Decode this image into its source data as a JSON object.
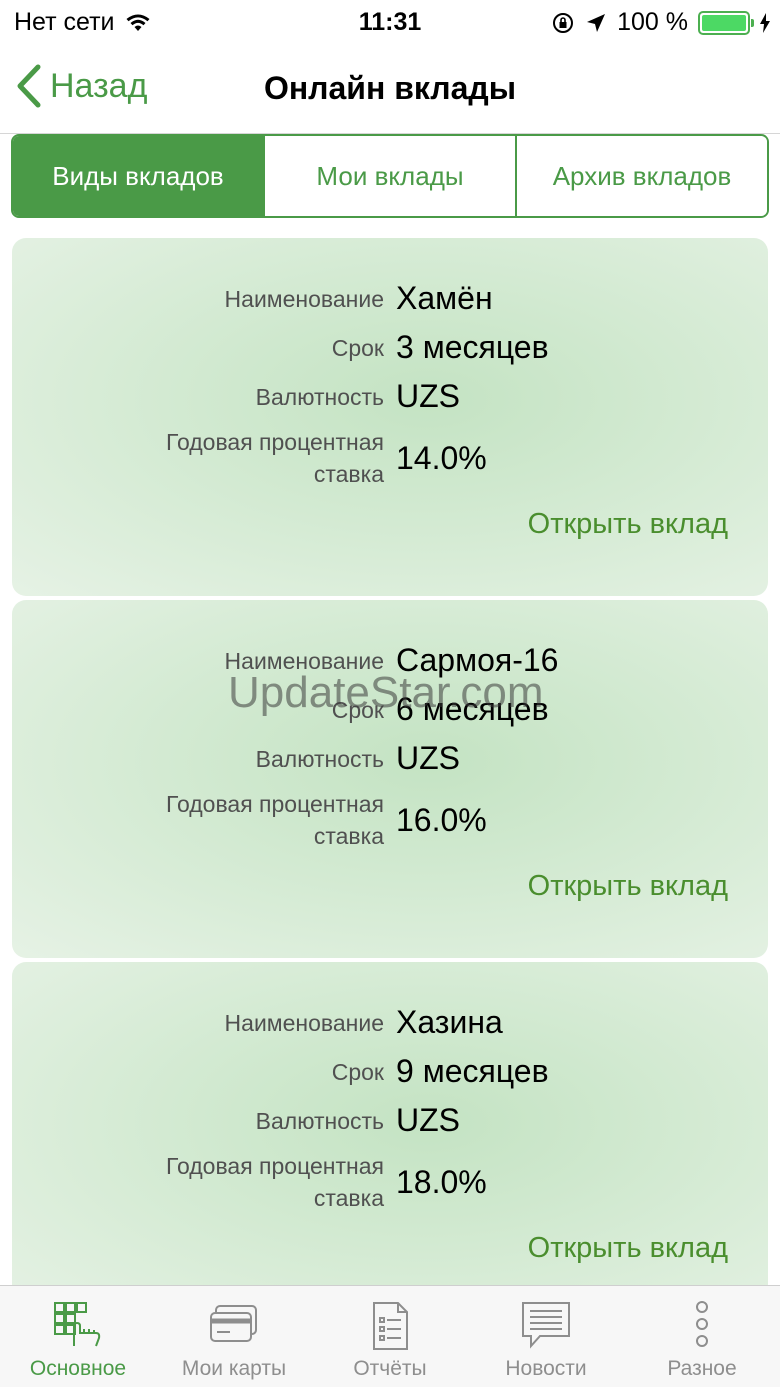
{
  "status_bar": {
    "carrier": "Нет сети",
    "time": "11:31",
    "battery": "100 %"
  },
  "nav": {
    "back_label": "Назад",
    "title": "Онлайн вклады"
  },
  "segments": [
    {
      "label": "Виды вкладов",
      "active": true
    },
    {
      "label": "Мои вклады",
      "active": false
    },
    {
      "label": "Архив вкладов",
      "active": false
    }
  ],
  "cards": [
    {
      "name_label": "Наименование",
      "name": "Хамён",
      "term_label": "Срок",
      "term": "3 месяцев",
      "currency_label": "Валютность",
      "currency": "UZS",
      "rate_label_1": "Годовая процентная",
      "rate_label_2": "ставка",
      "rate": "14.0%",
      "action": "Открыть вклад"
    },
    {
      "name_label": "Наименование",
      "name": "Сармоя-16",
      "term_label": "Срок",
      "term": "6 месяцев",
      "currency_label": "Валютность",
      "currency": "UZS",
      "rate_label_1": "Годовая процентная",
      "rate_label_2": "ставка",
      "rate": "16.0%",
      "action": "Открыть вклад"
    },
    {
      "name_label": "Наименование",
      "name": "Хазина",
      "term_label": "Срок",
      "term": "9 месяцев",
      "currency_label": "Валютность",
      "currency": "UZS",
      "rate_label_1": "Годовая процентная",
      "rate_label_2": "ставка",
      "rate": "18.0%",
      "action": "Открыть вклад"
    }
  ],
  "watermark": "UpdateStar.com",
  "tabs": [
    {
      "label": "Основное",
      "icon": "grid-hand-icon",
      "active": true
    },
    {
      "label": "Мои карты",
      "icon": "card-icon",
      "active": false
    },
    {
      "label": "Отчёты",
      "icon": "report-icon",
      "active": false
    },
    {
      "label": "Новости",
      "icon": "news-icon",
      "active": false
    },
    {
      "label": "Разное",
      "icon": "more-icon",
      "active": false
    }
  ],
  "colors": {
    "accent": "#4a9a47",
    "link": "#4a8e2e",
    "card_bg": "#d3ead2"
  }
}
